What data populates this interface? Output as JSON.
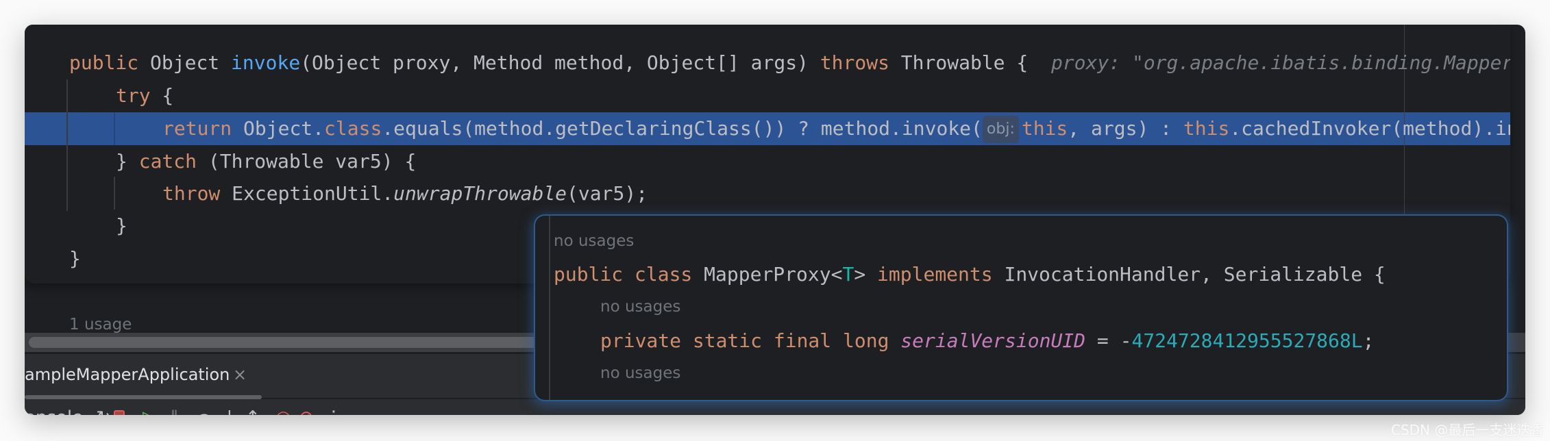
{
  "editor": {
    "line1": {
      "kw": "public",
      "type": "Object ",
      "name": "invoke",
      "rest": "(Object proxy, Method method, Object[] args) ",
      "throws": "throws",
      "after": " Throwable {",
      "hint": "proxy: \"org.apache.ibatis.binding.MapperP"
    },
    "line2": {
      "kw": "try",
      "rest": " {"
    },
    "line3": {
      "kw": "return",
      "a": " Object.",
      "cls": "class",
      "b": ".equals(method.getDeclaringClass()) ? method.invoke(",
      "inlay": "obj:",
      "this1": "this",
      "c": ", args) : ",
      "this2": "this",
      "d": ".cachedInvoker(method).invoke(proxy, method, args, this.sqlSession);"
    },
    "line4": {
      "a": "} ",
      "kw": "catch",
      "rest": " (Throwable var5) {"
    },
    "line5": {
      "kw": "throw",
      "a": " ExceptionUtil.",
      "method": "unwrapThrowable",
      "b": "(var5);"
    },
    "line6": "}",
    "line7": "}",
    "usage": "1 usage"
  },
  "popup": {
    "usage1": "no usages",
    "decl": {
      "kw": "public class",
      "a": " MapperProxy<",
      "tp": "T",
      "b": "> ",
      "impl": "implements",
      "c": " InvocationHandler, Serializable {"
    },
    "usage2": "no usages",
    "field": {
      "kw": "private static final long",
      "name": "serialVersionUID",
      "a": " = -",
      "num": "4724728412955527868L",
      "b": ";"
    },
    "usage3": "no usages"
  },
  "run_panel": {
    "tab_label": "ampleMapperApplication",
    "tab_close": "×",
    "console_label": "onsole",
    "toolbar_icons": [
      "rerun-icon",
      "stop-icon",
      "resume-icon",
      "pause-icon",
      "step-over-icon",
      "step-into-icon",
      "step-out-icon",
      "breakpoints-icon",
      "mute-breakpoints-icon",
      "more-icon"
    ]
  },
  "watermark": "CSDN @最后一支迷迭香",
  "colors": {
    "background": "#1e1f22",
    "keyword": "#cf8e6d",
    "method": "#56a8f5",
    "selection": "#2c5394",
    "field": "#c77dbb",
    "number": "#2aacb8"
  }
}
